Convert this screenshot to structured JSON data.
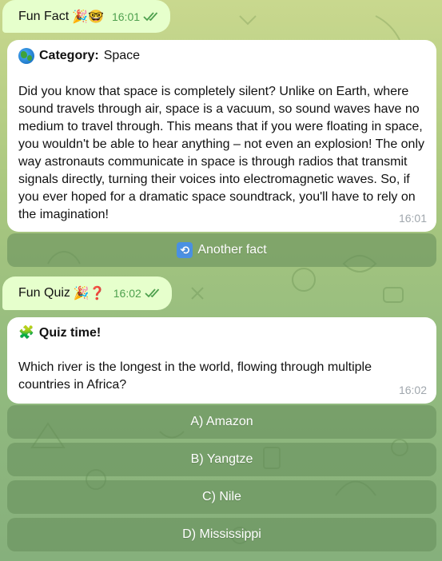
{
  "messages": {
    "fun_fact_header": {
      "label": "Fun Fact",
      "emojis": "🎉🤓",
      "time": "16:01"
    },
    "fact": {
      "category_label": "Category:",
      "category_value": "Space",
      "text": "Did you know that space is completely silent? Unlike on Earth, where sound travels through air, space is a vacuum, so sound waves have no medium to travel through. This means that if you were floating in space, you wouldn't be able to hear anything – not even an explosion! The only way astronauts communicate in space is through radios that transmit signals directly, turning their voices into electromagnetic waves. So, if you ever hoped for a dramatic space soundtrack, you'll have to rely on the imagination!",
      "time": "16:01"
    },
    "another_fact_button": {
      "icon": "🔁",
      "label": "Another fact"
    },
    "fun_quiz_header": {
      "label": "Fun Quiz",
      "emojis": "🎉❓",
      "time": "16:02"
    },
    "quiz": {
      "icon": "🧩",
      "title": "Quiz time!",
      "question": "Which river is the longest in the world, flowing through multiple countries in Africa?",
      "time": "16:02"
    },
    "answers": [
      {
        "label": "A) Amazon"
      },
      {
        "label": "B) Yangtze"
      },
      {
        "label": "C) Nile"
      },
      {
        "label": "D) Mississippi"
      }
    ]
  },
  "colors": {
    "outgoing_bubble": "#e6ffcc",
    "incoming_bubble": "#ffffff",
    "button_overlay": "#648c5a",
    "check_color": "#4ea04e"
  }
}
